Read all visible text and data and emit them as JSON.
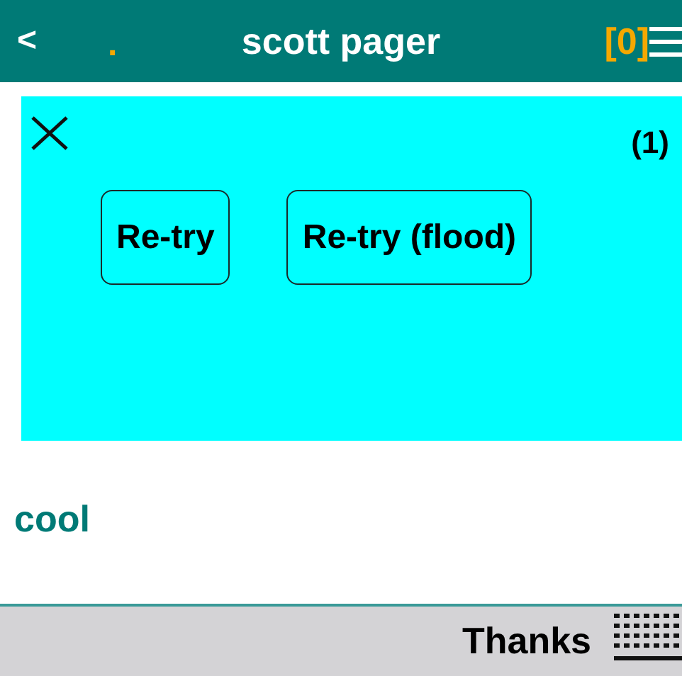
{
  "header": {
    "back": "<",
    "indicator": ".",
    "title": "scott pager",
    "count": "[0]"
  },
  "messages": [
    {
      "text": "cool",
      "kind": "received"
    }
  ],
  "popup": {
    "counter": "(1)",
    "buttons": [
      "Re-try",
      "Re-try (flood)"
    ]
  },
  "footer": {
    "action": "Thanks"
  }
}
